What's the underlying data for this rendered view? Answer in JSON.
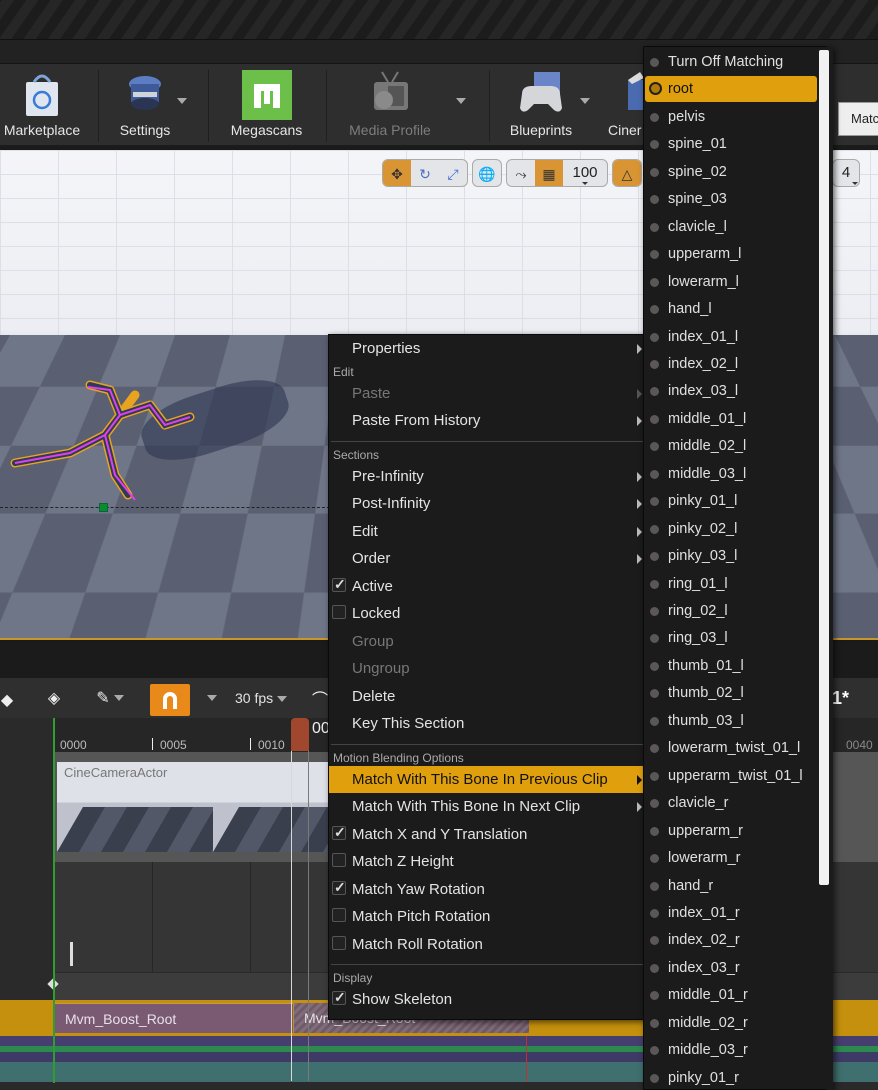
{
  "toolbar": {
    "buttons": [
      {
        "label": "Marketplace",
        "icon": "marketplace-bag-icon",
        "enabled": true
      },
      {
        "label": "Settings",
        "icon": "settings-gear-icon",
        "enabled": true,
        "has_dropdown": true
      },
      {
        "label": "Megascans",
        "icon": "megascans-logo-icon",
        "enabled": true
      },
      {
        "label": "Media Profile",
        "icon": "media-profile-tv-icon",
        "enabled": false,
        "has_dropdown": true
      },
      {
        "label": "Blueprints",
        "icon": "blueprints-gamepad-icon",
        "enabled": true,
        "has_dropdown": true
      },
      {
        "label": "Ciner",
        "icon": "cinematics-clapper-icon",
        "enabled": true
      }
    ],
    "match_button_label": "Matc"
  },
  "viewport_toolbar": {
    "transform_modes": [
      "translate",
      "rotate",
      "scale"
    ],
    "active_mode": "translate",
    "grid_snap_value": "100",
    "camera_speed_value": "4"
  },
  "sequencer": {
    "frame_rate": "30 fps",
    "time_partial": "00",
    "right_label": "1*",
    "ruler_ticks": [
      "0000",
      "0005",
      "0010",
      "0040"
    ],
    "camera_track_label": "CineCameraActor",
    "clips": [
      "Mvm_Boost_Root",
      "Mvm_Boost_Root"
    ],
    "colors": {
      "accent": "#e8891a",
      "playhead": "#a0472e",
      "anim_track": "#c4900d"
    }
  },
  "context_menu": {
    "items": [
      {
        "type": "item",
        "label": "Properties",
        "submenu": true
      },
      {
        "type": "header",
        "label": "Edit"
      },
      {
        "type": "item",
        "label": "Paste",
        "submenu": true,
        "disabled": true
      },
      {
        "type": "item",
        "label": "Paste From History",
        "submenu": true
      },
      {
        "type": "separator"
      },
      {
        "type": "header",
        "label": "Sections"
      },
      {
        "type": "item",
        "label": "Pre-Infinity",
        "submenu": true
      },
      {
        "type": "item",
        "label": "Post-Infinity",
        "submenu": true
      },
      {
        "type": "item",
        "label": "Edit",
        "submenu": true
      },
      {
        "type": "item",
        "label": "Order",
        "submenu": true
      },
      {
        "type": "check",
        "label": "Active",
        "checked": true
      },
      {
        "type": "check",
        "label": "Locked",
        "checked": false
      },
      {
        "type": "item",
        "label": "Group",
        "disabled": true
      },
      {
        "type": "item",
        "label": "Ungroup",
        "disabled": true
      },
      {
        "type": "item",
        "label": "Delete"
      },
      {
        "type": "item",
        "label": "Key This Section"
      },
      {
        "type": "separator"
      },
      {
        "type": "header",
        "label": "Motion Blending Options"
      },
      {
        "type": "item",
        "label": "Match With This Bone In Previous Clip",
        "submenu": true,
        "highlighted": true
      },
      {
        "type": "item",
        "label": "Match With This Bone In Next Clip",
        "submenu": true
      },
      {
        "type": "check",
        "label": "Match X and Y Translation",
        "checked": true
      },
      {
        "type": "check",
        "label": "Match Z Height",
        "checked": false
      },
      {
        "type": "check",
        "label": "Match Yaw Rotation",
        "checked": true
      },
      {
        "type": "check",
        "label": "Match Pitch Rotation",
        "checked": false
      },
      {
        "type": "check",
        "label": "Match Roll Rotation",
        "checked": false
      },
      {
        "type": "separator"
      },
      {
        "type": "header",
        "label": "Display"
      },
      {
        "type": "check",
        "label": "Show Skeleton",
        "checked": true
      }
    ]
  },
  "bone_menu": {
    "selected": "root",
    "items": [
      "Turn Off Matching",
      "root",
      "pelvis",
      "spine_01",
      "spine_02",
      "spine_03",
      "clavicle_l",
      "upperarm_l",
      "lowerarm_l",
      "hand_l",
      "index_01_l",
      "index_02_l",
      "index_03_l",
      "middle_01_l",
      "middle_02_l",
      "middle_03_l",
      "pinky_01_l",
      "pinky_02_l",
      "pinky_03_l",
      "ring_01_l",
      "ring_02_l",
      "ring_03_l",
      "thumb_01_l",
      "thumb_02_l",
      "thumb_03_l",
      "lowerarm_twist_01_l",
      "upperarm_twist_01_l",
      "clavicle_r",
      "upperarm_r",
      "lowerarm_r",
      "hand_r",
      "index_01_r",
      "index_02_r",
      "index_03_r",
      "middle_01_r",
      "middle_02_r",
      "middle_03_r",
      "pinky_01_r"
    ],
    "highlight_color": "#e0a00d"
  }
}
